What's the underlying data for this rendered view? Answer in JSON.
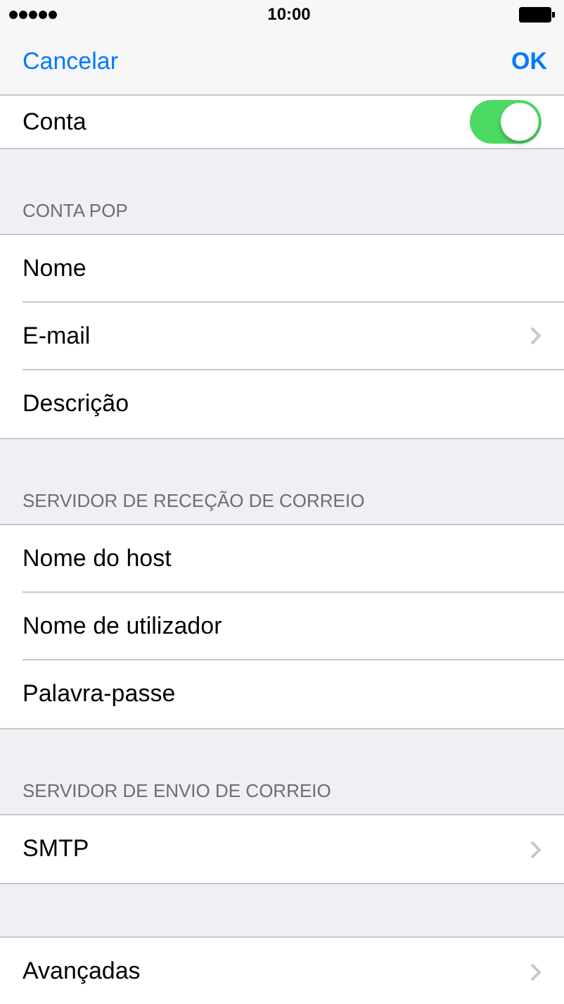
{
  "status_bar": {
    "time": "10:00"
  },
  "nav": {
    "left": "Cancelar",
    "right": "OK"
  },
  "sections": [
    {
      "rows": [
        {
          "label": "Conta",
          "kind": "toggle",
          "on": true
        }
      ]
    },
    {
      "header": "CONTA POP",
      "rows": [
        {
          "label": "Nome",
          "kind": "text"
        },
        {
          "label": "E-mail",
          "kind": "link"
        },
        {
          "label": "Descrição",
          "kind": "text"
        }
      ]
    },
    {
      "header": "SERVIDOR DE RECEÇÃO DE CORREIO",
      "rows": [
        {
          "label": "Nome do host",
          "kind": "text"
        },
        {
          "label": "Nome de utilizador",
          "kind": "text"
        },
        {
          "label": "Palavra-passe",
          "kind": "text"
        }
      ]
    },
    {
      "header": "SERVIDOR DE ENVIO DE CORREIO",
      "rows": [
        {
          "label": "SMTP",
          "kind": "link"
        }
      ]
    },
    {
      "rows": [
        {
          "label": "Avançadas",
          "kind": "link"
        }
      ]
    }
  ]
}
